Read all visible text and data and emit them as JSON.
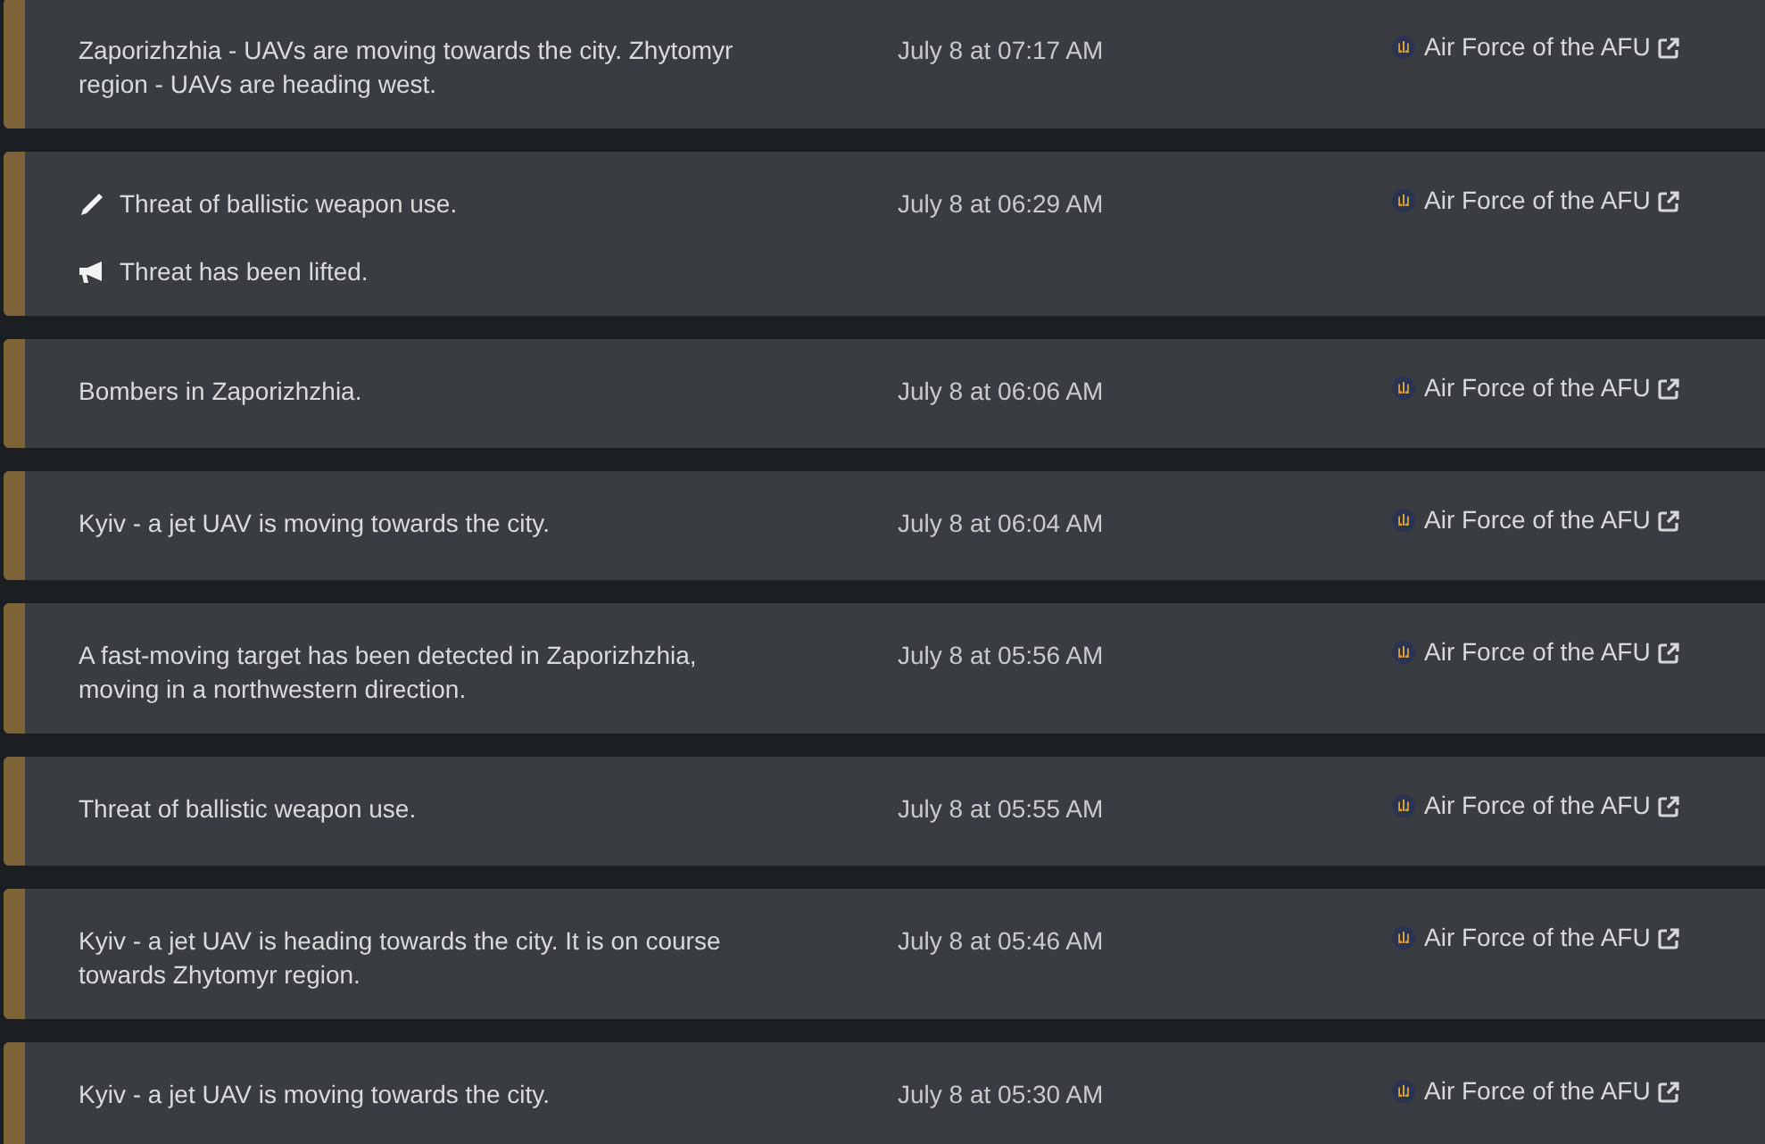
{
  "alerts": [
    {
      "messages": [
        {
          "kind": "text",
          "text": "Zaporizhzhia - UAVs are moving towards the city. Zhytomyr region - UAVs are heading west."
        }
      ],
      "time": "July 8 at 07:17 AM",
      "source": "Air Force of the AFU"
    },
    {
      "messages": [
        {
          "kind": "edit",
          "text": "Threat of ballistic weapon use."
        },
        {
          "kind": "lifted",
          "text": "Threat has been lifted."
        }
      ],
      "time": "July 8 at 06:29 AM",
      "source": "Air Force of the AFU"
    },
    {
      "messages": [
        {
          "kind": "text",
          "text": "Bombers in Zaporizhzhia."
        }
      ],
      "time": "July 8 at 06:06 AM",
      "source": "Air Force of the AFU"
    },
    {
      "messages": [
        {
          "kind": "text",
          "text": "Kyiv - a jet UAV is moving towards the city."
        }
      ],
      "time": "July 8 at 06:04 AM",
      "source": "Air Force of the AFU"
    },
    {
      "messages": [
        {
          "kind": "text",
          "text": "A fast-moving target has been detected in Zaporizhzhia, moving in a northwestern direction."
        }
      ],
      "time": "July 8 at 05:56 AM",
      "source": "Air Force of the AFU"
    },
    {
      "messages": [
        {
          "kind": "text",
          "text": "Threat of ballistic weapon use."
        }
      ],
      "time": "July 8 at 05:55 AM",
      "source": "Air Force of the AFU"
    },
    {
      "messages": [
        {
          "kind": "text",
          "text": "Kyiv - a jet UAV is heading towards the city. It is on course towards Zhytomyr region."
        }
      ],
      "time": "July 8 at 05:46 AM",
      "source": "Air Force of the AFU"
    },
    {
      "messages": [
        {
          "kind": "text",
          "text": "Kyiv - a jet UAV is moving towards the city."
        }
      ],
      "time": "July 8 at 05:30 AM",
      "source": "Air Force of the AFU"
    }
  ]
}
